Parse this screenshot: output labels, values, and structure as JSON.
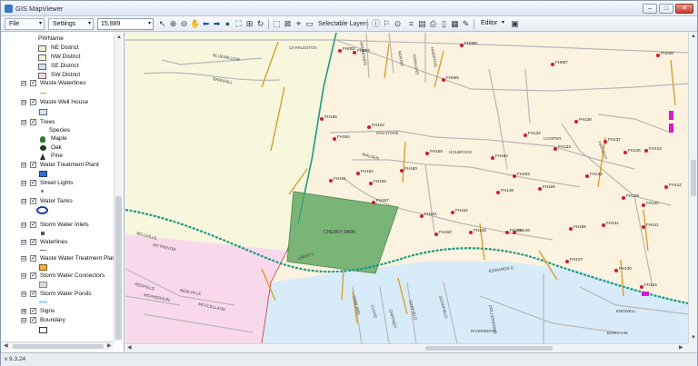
{
  "window": {
    "title": "GIS MapViewer",
    "minimize": "–",
    "maximize": "□",
    "close": "✕"
  },
  "toolbar": {
    "file_label": "File",
    "settings_label": "Settings",
    "scale_value": "15,889",
    "selectable_layers_label": "Selectable Layers",
    "editor_label": "Editor"
  },
  "toc": {
    "pwname_label": "PWName",
    "districts": [
      {
        "label": "NE District",
        "color": "#f6edd2"
      },
      {
        "label": "NW District",
        "color": "#f3f5dc"
      },
      {
        "label": "SE District",
        "color": "#cfe4f6"
      },
      {
        "label": "SW District",
        "color": "#f6d7e8"
      }
    ],
    "layers": [
      {
        "label": "Waste Waterlines",
        "expander": "⊟",
        "check": "✓"
      },
      {
        "label": "Waste Well House",
        "expander": "⊟",
        "check": "✓"
      },
      {
        "label": "Trees",
        "expander": "⊟",
        "check": "✓"
      },
      {
        "label": "Water Treatment Plant",
        "expander": "⊟",
        "check": "✓"
      },
      {
        "label": "Street Lights",
        "expander": "⊟",
        "check": "✓"
      },
      {
        "label": "Water Tanks",
        "expander": "⊟",
        "check": "✓"
      },
      {
        "label": "Storm Water Inlets",
        "expander": "⊟",
        "check": "✓"
      },
      {
        "label": "Waterlines",
        "expander": "⊟",
        "check": "✓"
      },
      {
        "label": "Waste Water Treatment Plant",
        "expander": "⊟",
        "check": "✓"
      },
      {
        "label": "Storm Water Connectors",
        "expander": "⊟",
        "check": "✓"
      },
      {
        "label": "Storm Water Ponds",
        "expander": "⊟",
        "check": "✓"
      },
      {
        "label": "Signs",
        "expander": "⊞",
        "check": "✓"
      },
      {
        "label": "Boundary",
        "expander": "⊟",
        "check": "✓"
      }
    ],
    "species_label": "Species",
    "species": [
      "Maple",
      "Oak",
      "Pine"
    ]
  },
  "map": {
    "colors": {
      "ne": "#fbf3df",
      "nw": "#f6f7dd",
      "se": "#d8ebf8",
      "sw": "#f8d9ec",
      "water_plant": "#7ab477",
      "waterline": "#1e9a82",
      "waste_line": "#d79a25",
      "hydrant": "#d31b2b",
      "road": "#b7b7b7"
    },
    "streets": [
      "CHARLESTON",
      "BLUEWILLOW",
      "BARNHILL",
      "HOLSTONE",
      "WALDEN",
      "HOLBROOK",
      "HAMMONDS",
      "NORRIS",
      "ROWLAND",
      "COOPER",
      "HAMPTON",
      "HARVEST",
      "BELLVILLE",
      "MCTREVOR",
      "REDFIELD",
      "MCPHERSON",
      "BEALVILLE",
      "MCCLELLAND",
      "LIBERTY",
      "GARLAND",
      "CLOVE",
      "GAFFNEY",
      "GARFIELD",
      "SCHOFIELD",
      "DOLLERWOOD",
      "ENDWELL",
      "RIVERWOOD",
      "BARNHAM",
      "EDWARDS D"
    ],
    "plant_label": "CHERRY PARK",
    "hydrants": [
      "FH089",
      "FH087",
      "FH238",
      "FH185",
      "FH163",
      "FH164",
      "FH159",
      "FH134",
      "FH138",
      "FH133",
      "FH137",
      "FH136",
      "FH143",
      "FH161",
      "FH162",
      "FH158",
      "FH157",
      "FH160",
      "FH153",
      "FH154",
      "FH132",
      "FH139",
      "FH142",
      "FH155",
      "FH149",
      "FH151",
      "FH152",
      "FH150",
      "FH145",
      "FH146",
      "FH156",
      "FH131",
      "FH140",
      "FH141",
      "FH148",
      "FH147",
      "FH130",
      "FH144",
      "FH004",
      "FH002",
      "FH005"
    ]
  },
  "status": {
    "version": "v 9.3.24"
  }
}
